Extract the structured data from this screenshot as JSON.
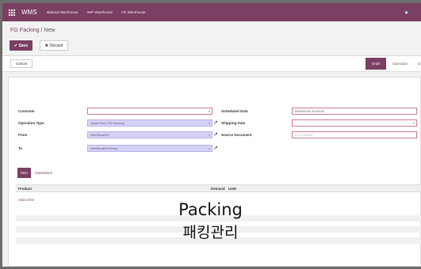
{
  "navbar": {
    "brand": "WMS",
    "menu": [
      "Material Warehouse",
      "WIP Warehouse",
      "FG Warehouse"
    ],
    "icon": "chat-bubble-icon"
  },
  "breadcrumb": {
    "parent": "FG Packing",
    "separator": " / ",
    "current": "New"
  },
  "actions": {
    "save": "✔ Save",
    "discard": "✖ Discard"
  },
  "statusbar": {
    "cancel": "Cancel",
    "stages": [
      "Draft",
      "Operation",
      "D"
    ]
  },
  "form": {
    "customer": {
      "label": "Customer",
      "value": ""
    },
    "operation_type": {
      "label": "Operation Type",
      "value": "Jewel Park: FG Packing"
    },
    "from": {
      "label": "From",
      "value": "WH/Stock/FG"
    },
    "to": {
      "label": "To",
      "value": "WH/Stock/FG/Pack"
    },
    "scheduled_date": {
      "label": "Scheduled Date",
      "value": "09/03/2024 14:04:06"
    },
    "shipping_date": {
      "label": "Shipping Date",
      "value": ""
    },
    "source_document": {
      "label": "Source Document",
      "placeholder": "e.g. PO0032"
    }
  },
  "tabs": {
    "item": "Item",
    "operations": "Operations"
  },
  "table": {
    "columns": [
      "Product",
      "Demand",
      "UoM"
    ],
    "add_line": "Add a line"
  },
  "overlay": {
    "line1": "Packing",
    "line2": "패킹관리"
  },
  "colors": {
    "brand": "#7b3f63",
    "field_fill": "#d6d2f7"
  }
}
